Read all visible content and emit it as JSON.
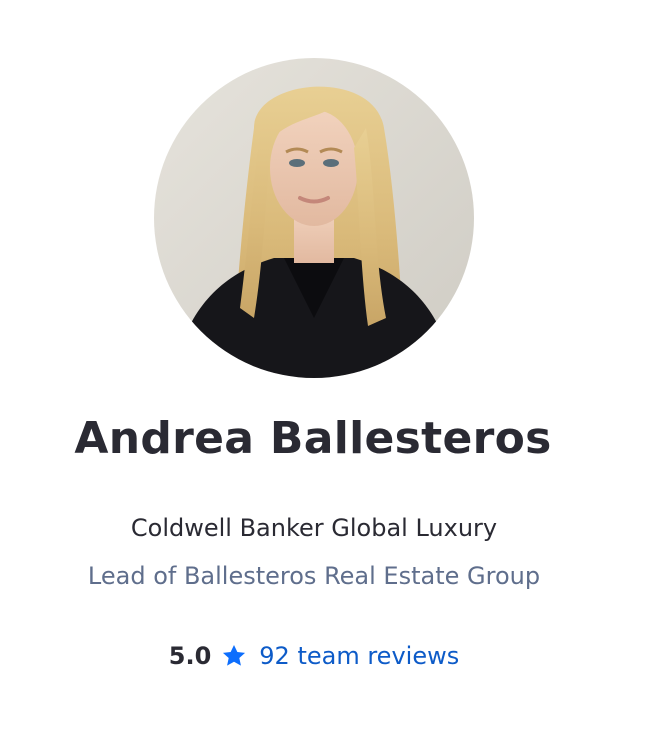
{
  "agent": {
    "name": "Andrea Ballesteros",
    "company": "Coldwell Banker Global Luxury",
    "title": "Lead of Ballesteros Real Estate Group",
    "rating": "5.0",
    "reviews_link": "92 team reviews"
  },
  "icons": {
    "rating": "star-icon"
  },
  "colors": {
    "name_text": "#2a2a33",
    "title_text": "#5f6e8c",
    "link": "#0d5bc8",
    "star": "#0d6efd"
  }
}
